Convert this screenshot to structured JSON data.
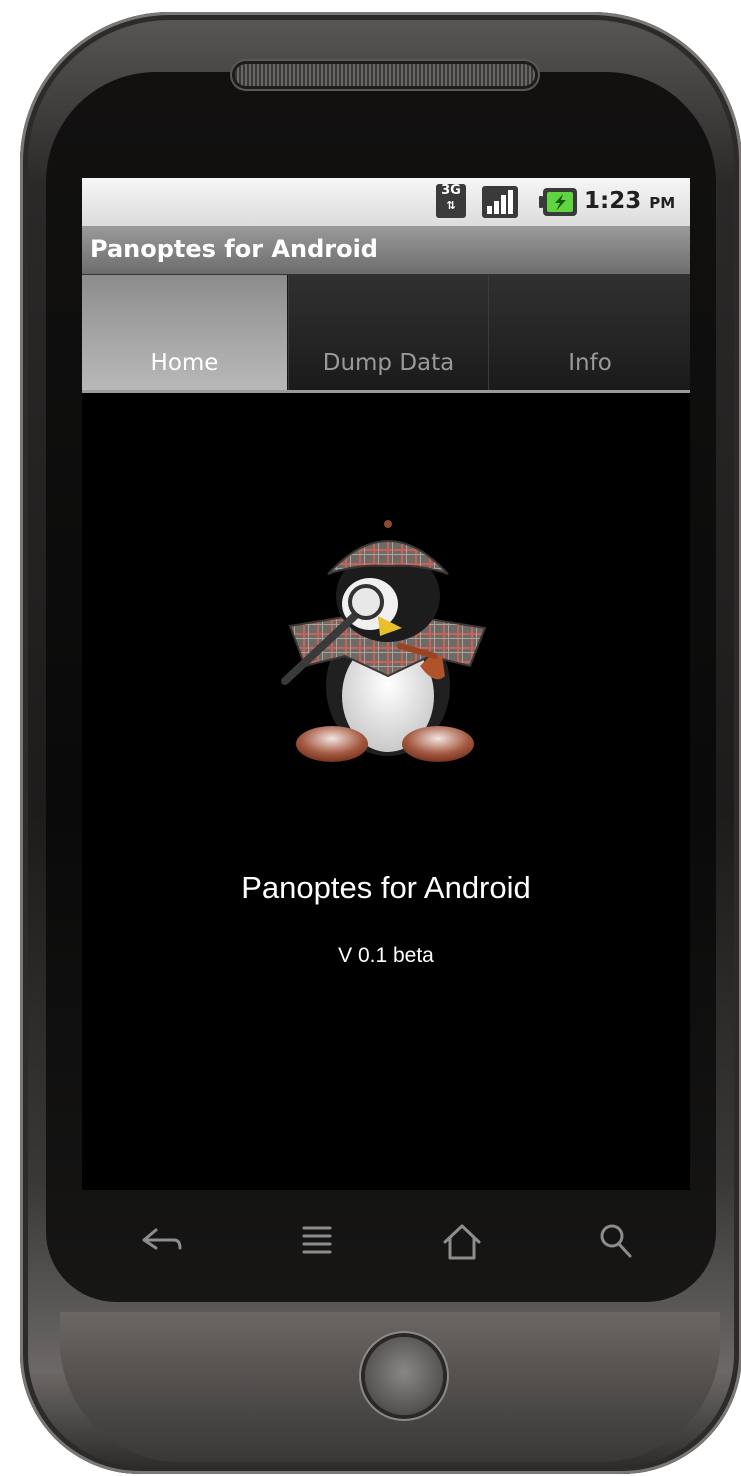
{
  "status_bar": {
    "network_type": "3G",
    "time": "1:23",
    "ampm": "PM",
    "icons": [
      "3g-data-icon",
      "signal-icon",
      "battery-charging-icon"
    ]
  },
  "title_bar": {
    "title": "Panoptes for Android"
  },
  "tabs": [
    {
      "label": "Home",
      "selected": true
    },
    {
      "label": "Dump Data",
      "selected": false
    },
    {
      "label": "Info",
      "selected": false
    }
  ],
  "main": {
    "logo_icon": "sherlock-penguin-icon",
    "app_name": "Panoptes for Android",
    "version": "V 0.1 beta"
  },
  "nav_buttons": [
    "back-icon",
    "menu-icon",
    "home-icon",
    "search-icon"
  ],
  "colors": {
    "tab_selected": "#a8a8a8",
    "tab_unselected": "#262626",
    "screen_bg": "#000000",
    "title_bar": "#7a7a7a"
  }
}
